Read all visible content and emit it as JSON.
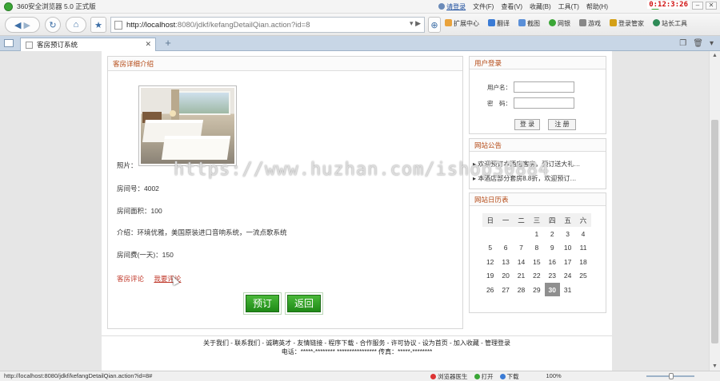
{
  "browser": {
    "title": "360安全浏览器 5.0 正式版",
    "login_label": "请登录",
    "menus": [
      "文件(F)",
      "查看(V)",
      "收藏(B)",
      "工具(T)",
      "帮助(H)"
    ],
    "clock": "0:12:3:26",
    "address": {
      "host": "http://localhost",
      "rest": ":8080/jdkf/kefangDetailQian.action?id=8"
    },
    "nav_tools": [
      "扩展中心",
      "翻译",
      "截图",
      "网银",
      "游戏",
      "登录管家",
      "站长工具"
    ],
    "tab": {
      "label": "客房预订系统"
    },
    "status": {
      "url": "http://localhost:8080/jdkf/kefangDetailQian.action?id=8#",
      "tools": [
        "浏览器医生",
        "打开",
        "下载"
      ],
      "zoom": "100%"
    }
  },
  "room_detail": {
    "title": "客房详细介绍",
    "photo_label": "照片：",
    "room_no": "房间号：4002",
    "area": "房间面积：100",
    "intro": "介绍：环境优雅，美国原装进口音响系统，一流点歌系统",
    "price": "房间费(一天)：150",
    "review_link": "客房评论",
    "my_review_link": "我要评论",
    "book_button": "预订",
    "back_button": "返回"
  },
  "login": {
    "title": "用户登录",
    "username_label": "用户名：",
    "password_label": "密　码：",
    "login_button": "登 录",
    "register_button": "注 册"
  },
  "notices": {
    "title": "网站公告",
    "items": [
      "欢迎预订本酒店客房，预订送大礼…",
      "本酒店部分套房8.8折，欢迎预订…"
    ]
  },
  "calendar": {
    "title": "网站日历表",
    "weekdays": [
      "日",
      "一",
      "二",
      "三",
      "四",
      "五",
      "六"
    ],
    "weeks": [
      [
        "",
        "",
        "",
        "1",
        "2",
        "3",
        "4"
      ],
      [
        "5",
        "6",
        "7",
        "8",
        "9",
        "10",
        "11"
      ],
      [
        "12",
        "13",
        "14",
        "15",
        "16",
        "17",
        "18"
      ],
      [
        "19",
        "20",
        "21",
        "22",
        "23",
        "24",
        "25"
      ],
      [
        "26",
        "27",
        "28",
        "29",
        "30",
        "31",
        ""
      ]
    ],
    "today": "30"
  },
  "footer": {
    "links": "关于我们 - 联系我们 - 诚聘英才 - 友情链接 - 程序下载 - 合作服务 - 许可协议 - 设为首页 - 加入收藏 - 管理登录",
    "contact": "电话：*****-******** **************** 传真：*****-********"
  },
  "watermark": "https://www.huzhan.com/ishop30884"
}
